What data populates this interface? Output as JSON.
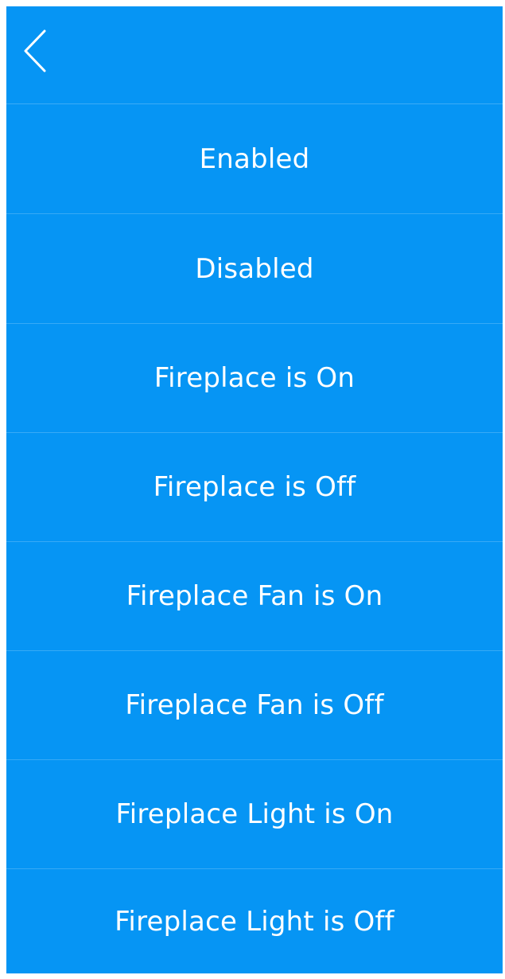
{
  "header": {
    "back_icon": "chevron-left-icon"
  },
  "options": [
    {
      "label": "Enabled"
    },
    {
      "label": "Disabled"
    },
    {
      "label": "Fireplace is On"
    },
    {
      "label": "Fireplace is Off"
    },
    {
      "label": "Fireplace Fan is On"
    },
    {
      "label": "Fireplace Fan is Off"
    },
    {
      "label": "Fireplace Light is On"
    },
    {
      "label": "Fireplace Light is Off"
    }
  ],
  "colors": {
    "background": "#0695f4",
    "text": "#ffffff"
  }
}
